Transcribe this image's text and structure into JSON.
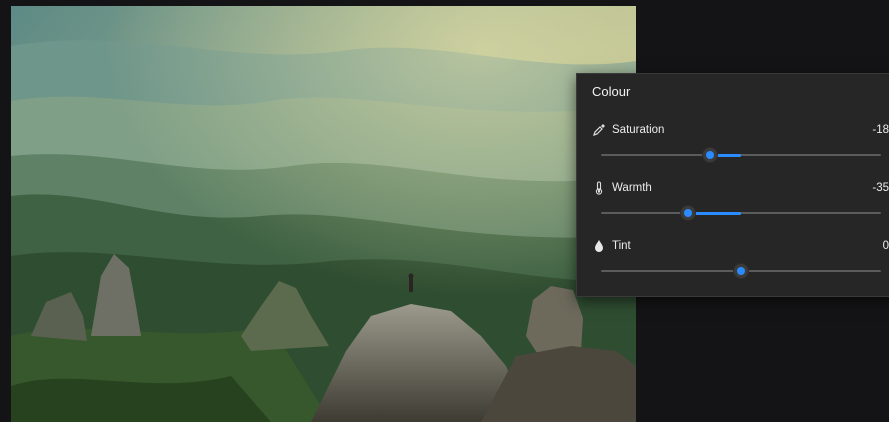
{
  "photo": {
    "description_icon": "landscape-photo"
  },
  "panel": {
    "title": "Colour",
    "accent": "#2a8cff",
    "sliders": [
      {
        "label": "Saturation",
        "value": "-18",
        "icon": "eyedropper-icon",
        "level": 0.39,
        "center": 0.5
      },
      {
        "label": "Warmth",
        "value": "-35",
        "icon": "thermometer-icon",
        "level": 0.31,
        "center": 0.5
      },
      {
        "label": "Tint",
        "value": "0",
        "icon": "droplet-icon",
        "level": 0.5,
        "center": 0.5
      }
    ]
  }
}
